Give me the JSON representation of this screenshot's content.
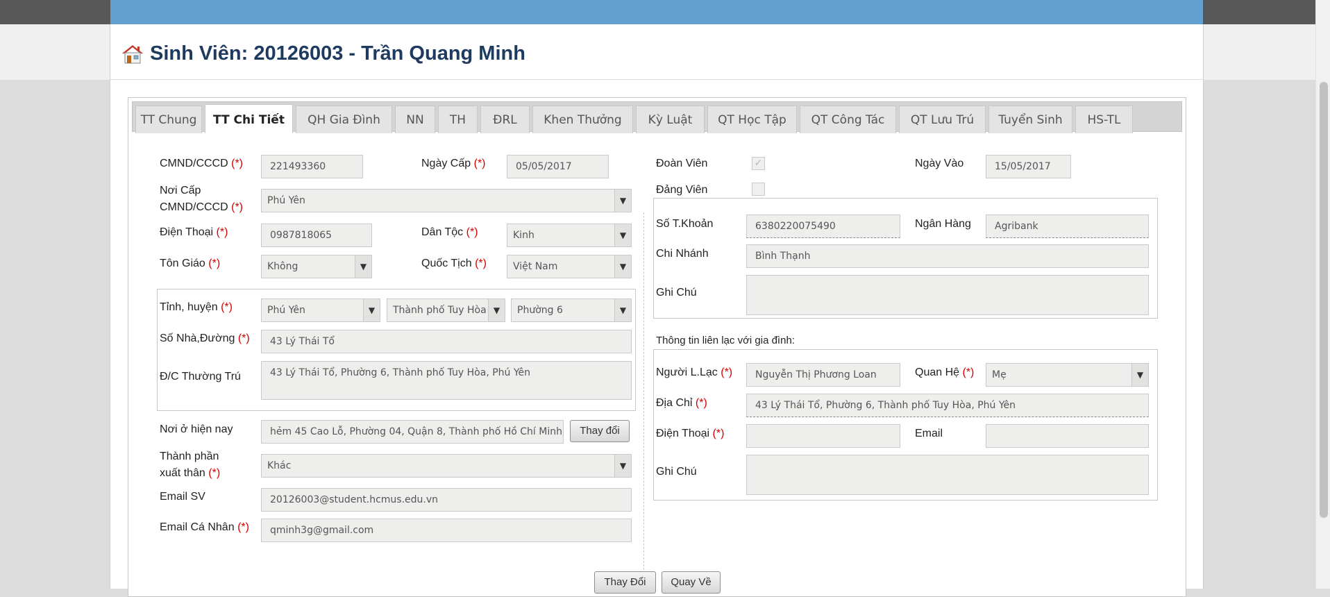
{
  "page": {
    "title": "Sinh Viên: 20126003 - Trần Quang Minh"
  },
  "tabs": [
    {
      "label": "TT Chung"
    },
    {
      "label": "TT Chi Tiết"
    },
    {
      "label": "QH Gia Đình"
    },
    {
      "label": "NN"
    },
    {
      "label": "TH"
    },
    {
      "label": "ĐRL"
    },
    {
      "label": "Khen Thưởng"
    },
    {
      "label": "Kỳ Luật"
    },
    {
      "label": "QT Học Tập"
    },
    {
      "label": "QT Công Tác"
    },
    {
      "label": "QT Lưu Trú"
    },
    {
      "label": "Tuyển Sinh"
    },
    {
      "label": "HS-TL"
    }
  ],
  "active_tab": "TT Chi Tiết",
  "required_mark": "(*)",
  "left": {
    "cmnd": {
      "label": "CMND/CCCD",
      "value": "221493360"
    },
    "ngay_cap": {
      "label": "Ngày Cấp",
      "value": "05/05/2017"
    },
    "noi_cap": {
      "label_line1": "Nơi Cấp",
      "label_line2": "CMND/CCCD",
      "value": "Phú Yên"
    },
    "dien_thoai": {
      "label": "Điện Thoại",
      "value": "0987818065"
    },
    "dan_toc": {
      "label": "Dân Tộc",
      "value": "Kinh"
    },
    "ton_giao": {
      "label": "Tôn Giáo",
      "value": "Không"
    },
    "quoc_tich": {
      "label": "Quốc Tịch",
      "value": "Việt Nam"
    },
    "tinh_huyen": {
      "label": "Tỉnh, huyện",
      "province": "Phú Yên",
      "district": "Thành phố Tuy Hòa",
      "ward": "Phường 6"
    },
    "so_nha": {
      "label": "Số Nhà,Đường",
      "value": "43 Lý Thái Tổ"
    },
    "dc_thuong_tru": {
      "label": "Đ/C Thường Trú",
      "value": "43 Lý Thái Tổ, Phường 6, Thành phố Tuy Hòa, Phú Yên"
    },
    "noi_o": {
      "label": "Nơi ở hiện nay",
      "value": "hẻm 45 Cao Lỗ, Phường 04, Quận 8, Thành phố Hồ Chí Minh",
      "button": "Thay đổi"
    },
    "thanh_phan": {
      "label_line1": "Thành phần",
      "label_line2": "xuất thân",
      "value": "Khác"
    },
    "email_sv": {
      "label": "Email SV",
      "value": "20126003@student.hcmus.edu.vn"
    },
    "email_cn": {
      "label": "Email Cá Nhân",
      "value": "qminh3g@gmail.com"
    }
  },
  "right": {
    "doan_vien": {
      "label": "Đoàn Viên",
      "checked": true
    },
    "ngay_vao": {
      "label": "Ngày Vào",
      "value": "15/05/2017"
    },
    "dang_vien": {
      "label": "Đảng Viên",
      "checked": false
    },
    "so_tk": {
      "label": "Số T.Khoản",
      "value": "6380220075490"
    },
    "ngan_hang": {
      "label": "Ngân Hàng",
      "value": "Agribank"
    },
    "chi_nhanh": {
      "label": "Chi Nhánh",
      "value": "Bình Thạnh"
    },
    "ghi_chu_1": {
      "label": "Ghi Chú",
      "value": ""
    },
    "contact_heading": "Thông tin liên lạc với gia đình:",
    "nguoi_lien_lac": {
      "label": "Người L.Lạc",
      "value": "Nguyễn Thị Phương Loan"
    },
    "quan_he": {
      "label": "Quan Hệ",
      "value": "Mẹ"
    },
    "dia_chi": {
      "label": "Địa Chỉ",
      "value": "43 Lý Thái Tổ, Phường 6, Thành phố Tuy Hòa, Phú Yên"
    },
    "dien_thoai_gd": {
      "label": "Điện Thoại",
      "value": ""
    },
    "email_gd": {
      "label": "Email",
      "value": ""
    },
    "ghi_chu_2": {
      "label": "Ghi Chú",
      "value": ""
    }
  },
  "actions": {
    "change_label": "Thay Đổi",
    "back_label": "Quay Về"
  },
  "colors": {
    "header_blue": "#63a0cf",
    "title": "#1e3b5f",
    "required": "#d40000"
  }
}
